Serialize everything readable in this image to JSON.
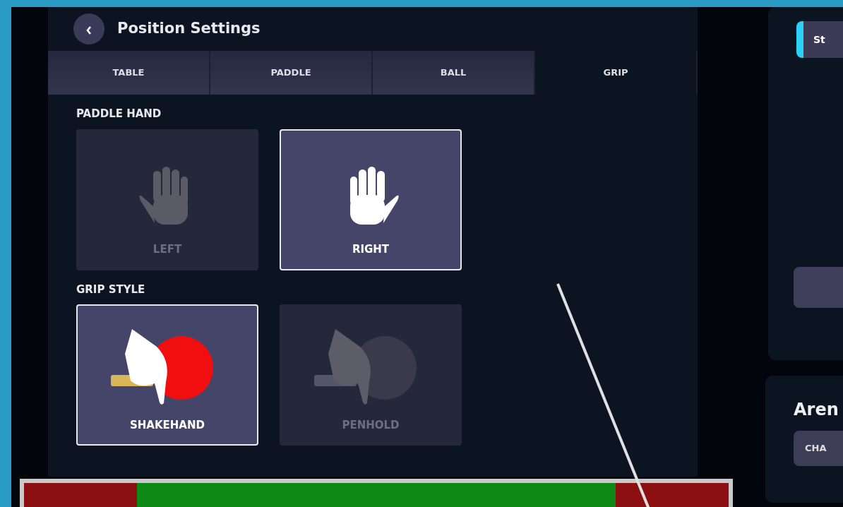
{
  "header": {
    "title": "Position Settings"
  },
  "tabs": [
    {
      "label": "TABLE",
      "selected": false
    },
    {
      "label": "PADDLE",
      "selected": false
    },
    {
      "label": "BALL",
      "selected": false
    },
    {
      "label": "GRIP",
      "selected": true
    }
  ],
  "sections": [
    {
      "title": "PADDLE HAND",
      "options": [
        {
          "label": "LEFT",
          "kind": "left-hand",
          "selected": false
        },
        {
          "label": "RIGHT",
          "kind": "right-hand",
          "selected": true
        }
      ]
    },
    {
      "title": "GRIP STYLE",
      "options": [
        {
          "label": "SHAKEHAND",
          "kind": "shakehand",
          "selected": true
        },
        {
          "label": "PENHOLD",
          "kind": "penhold",
          "selected": false
        }
      ]
    }
  ],
  "side_panel": {
    "buttons": [
      {
        "label": "St",
        "selected": true
      }
    ]
  },
  "arena": {
    "title": "Aren",
    "button": "CHA"
  }
}
